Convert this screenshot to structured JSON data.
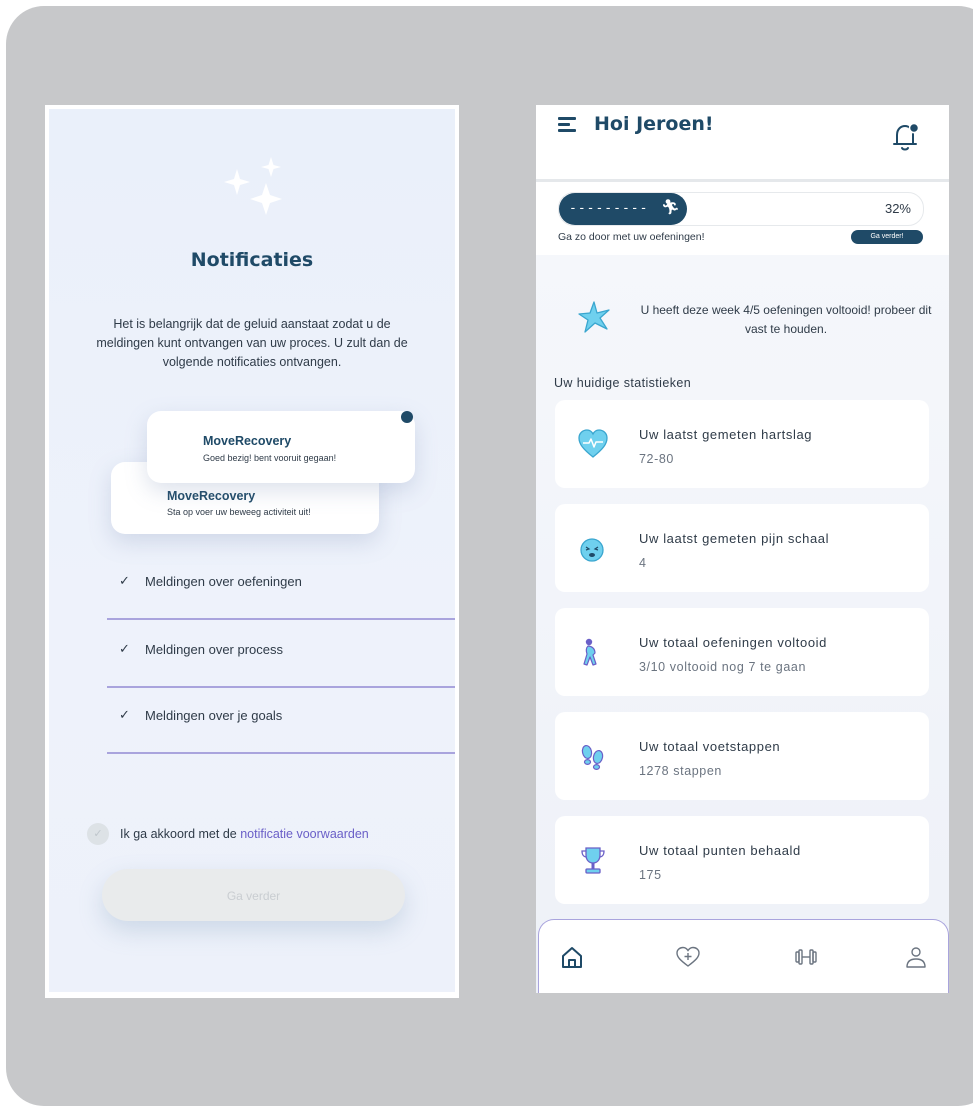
{
  "left_screen": {
    "title": "Notificaties",
    "description": "Het is belangrijk dat de geluid aanstaat zodat u de meldingen kunt ontvangen van uw proces. U zult dan de volgende notificaties ontvangen.",
    "preview_cards": [
      {
        "app": "MoveRecovery",
        "message": "Goed bezig! bent vooruit gegaan!"
      },
      {
        "app": "MoveRecovery",
        "message": "Sta op voer uw beweeg activiteit uit!"
      }
    ],
    "options": [
      {
        "label": "Meldingen over oefeningen"
      },
      {
        "label": "Meldingen over process"
      },
      {
        "label": "Meldingen over je goals"
      }
    ],
    "agree": {
      "part1": "Ik ga akkoord met de ",
      "part2": "notificatie voorwaarden",
      "check": "✓"
    },
    "continue_label": "Ga verder",
    "check_glyph": "✓"
  },
  "right_screen": {
    "greeting": "Hoi Jeroen!",
    "progress": {
      "percent": 32,
      "label": "32%",
      "dashes": "---------",
      "message": "Ga zo door met uw oefeningen!",
      "button": "Ga verder!"
    },
    "weekly": "U heeft deze week 4/5 oefeningen voltooid! probeer dit vast te houden.",
    "stats_title": "Uw huidige statistieken",
    "stats": [
      {
        "icon": "heart-rate-icon",
        "label": "Uw laatst gemeten hartslag",
        "value": "72-80"
      },
      {
        "icon": "pain-face-icon",
        "label": "Uw laatst gemeten pijn schaal",
        "value": "4"
      },
      {
        "icon": "exercise-person-icon",
        "label": "Uw totaal oefeningen voltooid",
        "value": "3/10 voltooid nog 7 te gaan"
      },
      {
        "icon": "footsteps-icon",
        "label": "Uw totaal voetstappen",
        "value": "1278 stappen"
      },
      {
        "icon": "trophy-icon",
        "label": "Uw totaal punten behaald",
        "value": "175"
      }
    ],
    "nav": [
      {
        "icon": "home-icon",
        "active": true
      },
      {
        "icon": "heart-icon",
        "active": false
      },
      {
        "icon": "dumbbell-icon",
        "active": false
      },
      {
        "icon": "profile-icon",
        "active": false
      }
    ]
  },
  "colors": {
    "navy": "#1f4a67",
    "accent": "#a9a4dd",
    "teal": "#4fc3e6",
    "purple": "#6a5fc7"
  }
}
